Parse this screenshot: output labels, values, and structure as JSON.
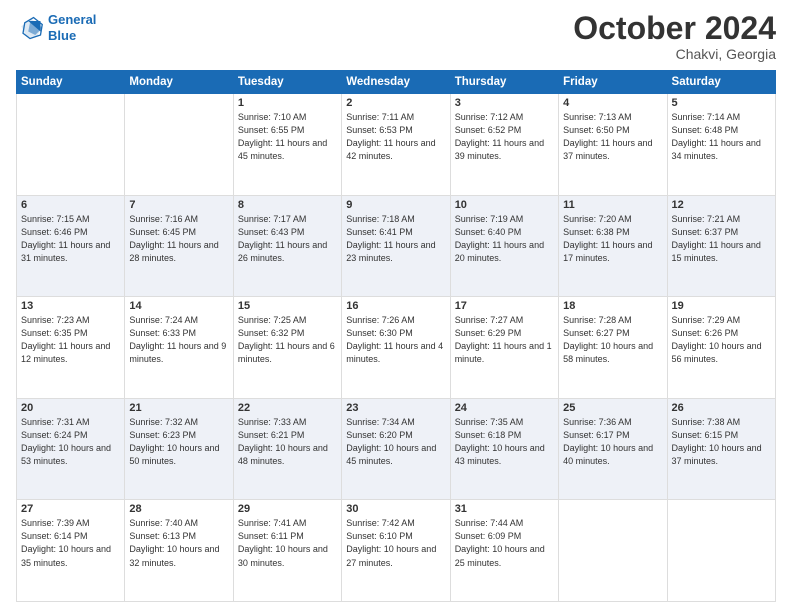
{
  "header": {
    "logo_line1": "General",
    "logo_line2": "Blue",
    "month": "October 2024",
    "location": "Chakvi, Georgia"
  },
  "days_of_week": [
    "Sunday",
    "Monday",
    "Tuesday",
    "Wednesday",
    "Thursday",
    "Friday",
    "Saturday"
  ],
  "weeks": [
    [
      {
        "day": "",
        "info": ""
      },
      {
        "day": "",
        "info": ""
      },
      {
        "day": "1",
        "info": "Sunrise: 7:10 AM\nSunset: 6:55 PM\nDaylight: 11 hours and 45 minutes."
      },
      {
        "day": "2",
        "info": "Sunrise: 7:11 AM\nSunset: 6:53 PM\nDaylight: 11 hours and 42 minutes."
      },
      {
        "day": "3",
        "info": "Sunrise: 7:12 AM\nSunset: 6:52 PM\nDaylight: 11 hours and 39 minutes."
      },
      {
        "day": "4",
        "info": "Sunrise: 7:13 AM\nSunset: 6:50 PM\nDaylight: 11 hours and 37 minutes."
      },
      {
        "day": "5",
        "info": "Sunrise: 7:14 AM\nSunset: 6:48 PM\nDaylight: 11 hours and 34 minutes."
      }
    ],
    [
      {
        "day": "6",
        "info": "Sunrise: 7:15 AM\nSunset: 6:46 PM\nDaylight: 11 hours and 31 minutes."
      },
      {
        "day": "7",
        "info": "Sunrise: 7:16 AM\nSunset: 6:45 PM\nDaylight: 11 hours and 28 minutes."
      },
      {
        "day": "8",
        "info": "Sunrise: 7:17 AM\nSunset: 6:43 PM\nDaylight: 11 hours and 26 minutes."
      },
      {
        "day": "9",
        "info": "Sunrise: 7:18 AM\nSunset: 6:41 PM\nDaylight: 11 hours and 23 minutes."
      },
      {
        "day": "10",
        "info": "Sunrise: 7:19 AM\nSunset: 6:40 PM\nDaylight: 11 hours and 20 minutes."
      },
      {
        "day": "11",
        "info": "Sunrise: 7:20 AM\nSunset: 6:38 PM\nDaylight: 11 hours and 17 minutes."
      },
      {
        "day": "12",
        "info": "Sunrise: 7:21 AM\nSunset: 6:37 PM\nDaylight: 11 hours and 15 minutes."
      }
    ],
    [
      {
        "day": "13",
        "info": "Sunrise: 7:23 AM\nSunset: 6:35 PM\nDaylight: 11 hours and 12 minutes."
      },
      {
        "day": "14",
        "info": "Sunrise: 7:24 AM\nSunset: 6:33 PM\nDaylight: 11 hours and 9 minutes."
      },
      {
        "day": "15",
        "info": "Sunrise: 7:25 AM\nSunset: 6:32 PM\nDaylight: 11 hours and 6 minutes."
      },
      {
        "day": "16",
        "info": "Sunrise: 7:26 AM\nSunset: 6:30 PM\nDaylight: 11 hours and 4 minutes."
      },
      {
        "day": "17",
        "info": "Sunrise: 7:27 AM\nSunset: 6:29 PM\nDaylight: 11 hours and 1 minute."
      },
      {
        "day": "18",
        "info": "Sunrise: 7:28 AM\nSunset: 6:27 PM\nDaylight: 10 hours and 58 minutes."
      },
      {
        "day": "19",
        "info": "Sunrise: 7:29 AM\nSunset: 6:26 PM\nDaylight: 10 hours and 56 minutes."
      }
    ],
    [
      {
        "day": "20",
        "info": "Sunrise: 7:31 AM\nSunset: 6:24 PM\nDaylight: 10 hours and 53 minutes."
      },
      {
        "day": "21",
        "info": "Sunrise: 7:32 AM\nSunset: 6:23 PM\nDaylight: 10 hours and 50 minutes."
      },
      {
        "day": "22",
        "info": "Sunrise: 7:33 AM\nSunset: 6:21 PM\nDaylight: 10 hours and 48 minutes."
      },
      {
        "day": "23",
        "info": "Sunrise: 7:34 AM\nSunset: 6:20 PM\nDaylight: 10 hours and 45 minutes."
      },
      {
        "day": "24",
        "info": "Sunrise: 7:35 AM\nSunset: 6:18 PM\nDaylight: 10 hours and 43 minutes."
      },
      {
        "day": "25",
        "info": "Sunrise: 7:36 AM\nSunset: 6:17 PM\nDaylight: 10 hours and 40 minutes."
      },
      {
        "day": "26",
        "info": "Sunrise: 7:38 AM\nSunset: 6:15 PM\nDaylight: 10 hours and 37 minutes."
      }
    ],
    [
      {
        "day": "27",
        "info": "Sunrise: 7:39 AM\nSunset: 6:14 PM\nDaylight: 10 hours and 35 minutes."
      },
      {
        "day": "28",
        "info": "Sunrise: 7:40 AM\nSunset: 6:13 PM\nDaylight: 10 hours and 32 minutes."
      },
      {
        "day": "29",
        "info": "Sunrise: 7:41 AM\nSunset: 6:11 PM\nDaylight: 10 hours and 30 minutes."
      },
      {
        "day": "30",
        "info": "Sunrise: 7:42 AM\nSunset: 6:10 PM\nDaylight: 10 hours and 27 minutes."
      },
      {
        "day": "31",
        "info": "Sunrise: 7:44 AM\nSunset: 6:09 PM\nDaylight: 10 hours and 25 minutes."
      },
      {
        "day": "",
        "info": ""
      },
      {
        "day": "",
        "info": ""
      }
    ]
  ]
}
